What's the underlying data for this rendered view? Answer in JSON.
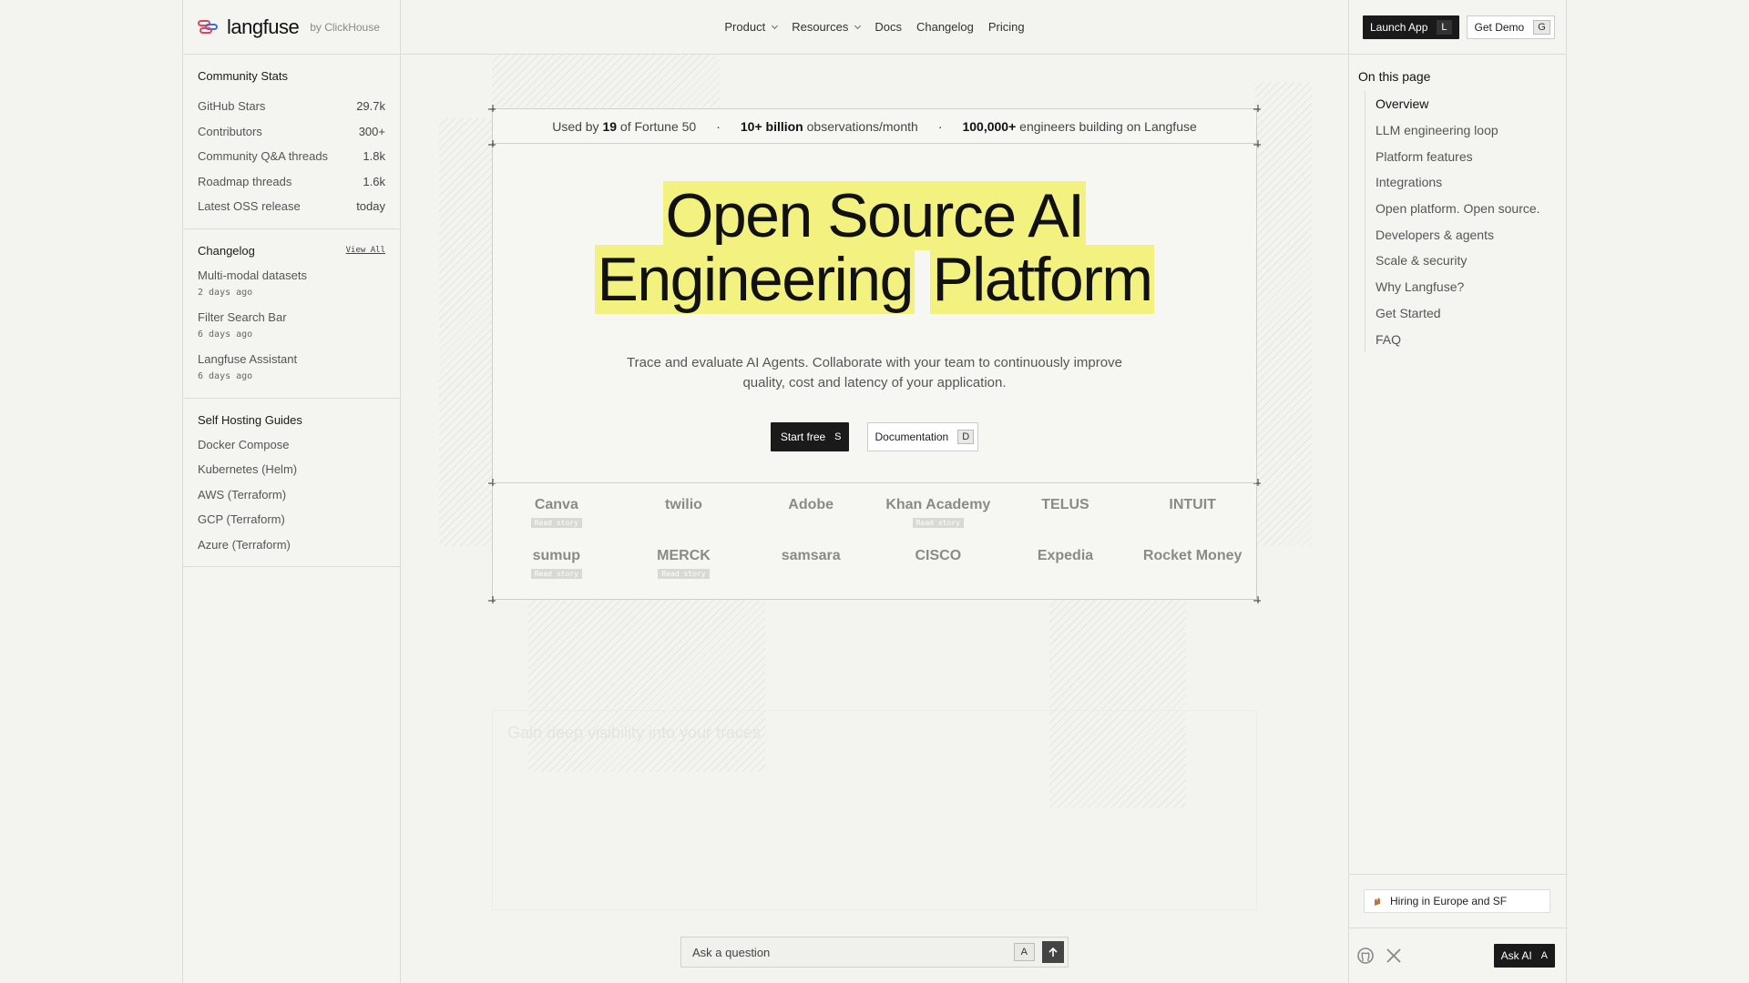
{
  "brand": {
    "name": "langfuse",
    "by": "by ClickHouse"
  },
  "nav": {
    "items": [
      {
        "label": "Product",
        "dropdown": true
      },
      {
        "label": "Resources",
        "dropdown": true
      },
      {
        "label": "Docs",
        "dropdown": false
      },
      {
        "label": "Changelog",
        "dropdown": false
      },
      {
        "label": "Pricing",
        "dropdown": false
      }
    ]
  },
  "header_ctas": {
    "launch_label": "Launch App",
    "launch_key": "L",
    "demo_label": "Get Demo",
    "demo_key": "G"
  },
  "community": {
    "title": "Community Stats",
    "rows": [
      {
        "label": "GitHub Stars",
        "value": "29.7k"
      },
      {
        "label": "Contributors",
        "value": "300+"
      },
      {
        "label": "Community Q&A threads",
        "value": "1.8k"
      },
      {
        "label": "Roadmap threads",
        "value": "1.6k"
      },
      {
        "label": "Latest OSS release",
        "value": "today"
      }
    ]
  },
  "changelog": {
    "title": "Changelog",
    "view_all": "View All",
    "items": [
      {
        "title": "Multi-modal datasets",
        "date": "2 days ago"
      },
      {
        "title": "Filter Search Bar",
        "date": "6 days ago"
      },
      {
        "title": "Langfuse Assistant",
        "date": "6 days ago"
      }
    ]
  },
  "self_hosting": {
    "title": "Self Hosting Guides",
    "items": [
      "Docker Compose",
      "Kubernetes (Helm)",
      "AWS (Terraform)",
      "GCP (Terraform)",
      "Azure (Terraform)"
    ]
  },
  "toc": {
    "title": "On this page",
    "items": [
      "Overview",
      "LLM engineering loop",
      "Platform features",
      "Integrations",
      "Open platform. Open source.",
      "Developers & agents",
      "Scale & security",
      "Why Langfuse?",
      "Get Started",
      "FAQ"
    ],
    "active_index": 0
  },
  "hiring": {
    "label": "Hiring in Europe and SF"
  },
  "ask_ai": {
    "label": "Ask AI",
    "key": "A"
  },
  "stats_strip": {
    "s1_pre": "Used by ",
    "s1_bold": "19",
    "s1_post": " of Fortune 50",
    "s2_bold": "10+ billion",
    "s2_post": " observations/month",
    "s3_bold": "100,000+",
    "s3_post": " engineers building on Langfuse",
    "separator": "·"
  },
  "hero": {
    "line1": "Open Source AI",
    "line2a": "Engineering",
    "line2b": "Platform",
    "subtitle_1": "Trace and evaluate AI Agents. Collaborate with your team to continuously improve",
    "subtitle_2": "quality, cost and latency of your application.",
    "start_label": "Start free",
    "start_key": "S",
    "docs_label": "Documentation",
    "docs_key": "D"
  },
  "logos": [
    {
      "name": "Canva",
      "story": "Read story"
    },
    {
      "name": "twilio",
      "story": ""
    },
    {
      "name": "Adobe",
      "story": ""
    },
    {
      "name": "Khan Academy",
      "story": "Read story"
    },
    {
      "name": "TELUS",
      "story": ""
    },
    {
      "name": "INTUIT",
      "story": ""
    },
    {
      "name": "sumup",
      "story": "Read story"
    },
    {
      "name": "MERCK",
      "story": "Read story"
    },
    {
      "name": "samsara",
      "story": ""
    },
    {
      "name": "CISCO",
      "story": ""
    },
    {
      "name": "Expedia",
      "story": ""
    },
    {
      "name": "Rocket Money",
      "story": ""
    }
  ],
  "faded_section": {
    "title": "Gain deep visibility into your traces"
  },
  "ask_bar": {
    "placeholder": "Ask a question",
    "key": "A"
  },
  "colors": {
    "highlight": "#f3f281",
    "dark": "#1a1a1a",
    "background": "#f3f3f0"
  }
}
